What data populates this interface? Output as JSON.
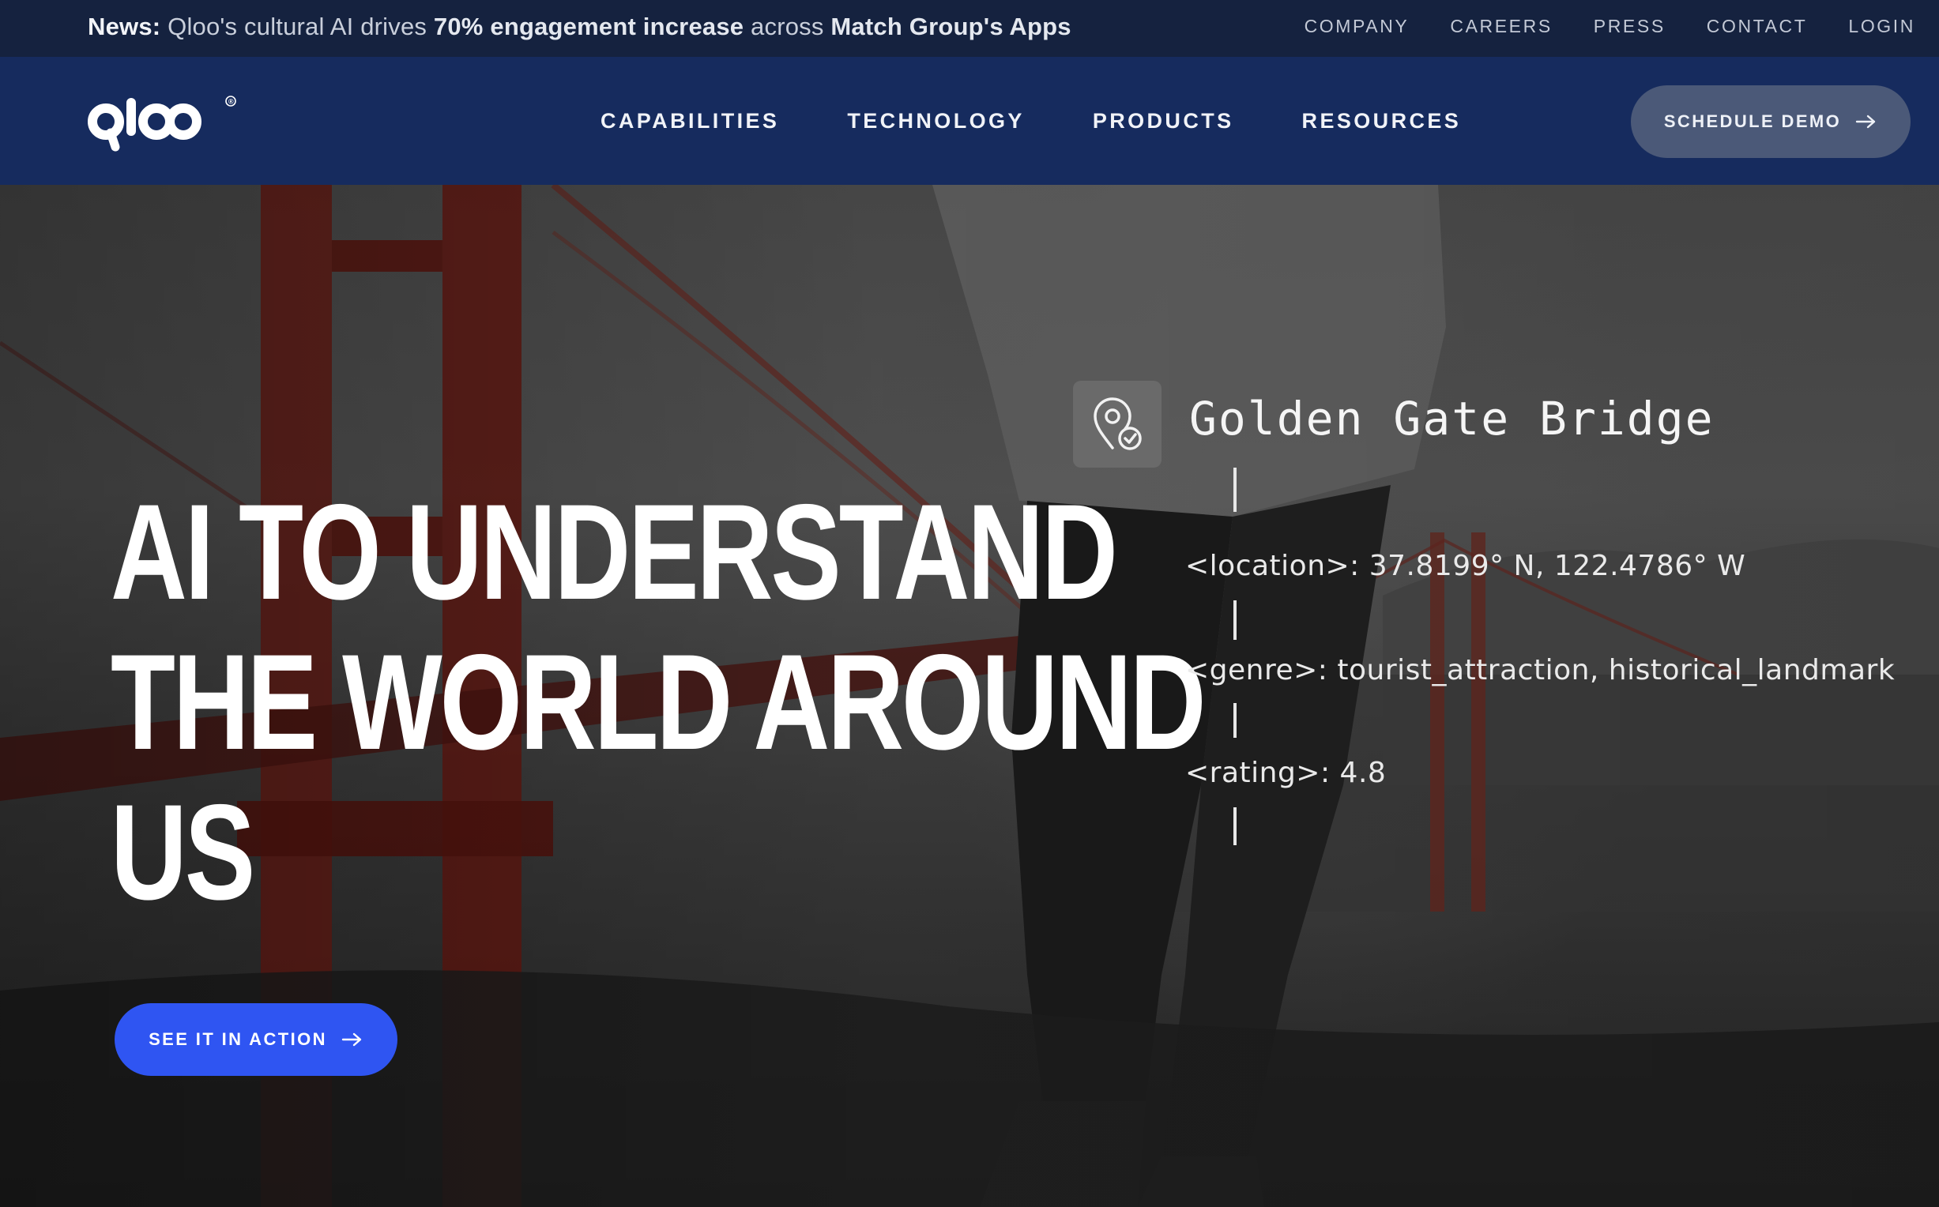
{
  "topbar": {
    "news_label": "News:",
    "news_text_1": "Qloo's cultural AI drives",
    "news_highlight_1": "70% engagement increase",
    "news_text_2": "across",
    "news_highlight_2": "Match Group's Apps",
    "links": [
      "COMPANY",
      "CAREERS",
      "PRESS",
      "CONTACT",
      "LOGIN"
    ]
  },
  "nav": {
    "logo_text": "qloo",
    "logo_mark": "®",
    "links": [
      "CAPABILITIES",
      "TECHNOLOGY",
      "PRODUCTS",
      "RESOURCES"
    ],
    "cta_label": "SCHEDULE DEMO"
  },
  "hero": {
    "headline_lines": [
      "AI TO UNDERSTAND",
      "THE WORLD AROUND",
      "US"
    ],
    "cta_label": "SEE IT IN ACTION",
    "entity": {
      "icon": "map-pin-check-icon",
      "title": "Golden Gate Bridge",
      "location": "<location>: 37.8199° N, 122.4786° W",
      "genre": "<genre>: tourist_attraction, historical_landmark",
      "rating": "<rating>: 4.8"
    }
  },
  "colors": {
    "topbar_bg": "#15223f",
    "nav_bg": "#162b5e",
    "demo_button_bg": "#4b5978",
    "cta_button_bg": "#2f55f2",
    "bridge_red": "#7a1c14"
  }
}
